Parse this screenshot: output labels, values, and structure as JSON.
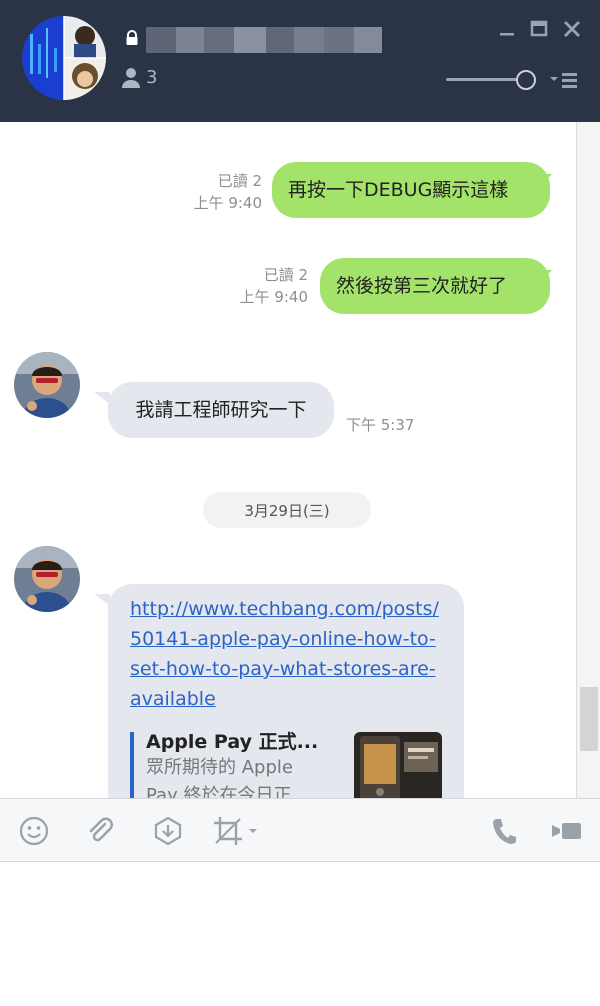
{
  "header": {
    "member_count": "3",
    "icons": [
      "lock-icon",
      "member-icon",
      "minimize-icon",
      "maximize-icon",
      "close-icon",
      "zoom-slider",
      "menu-icon"
    ]
  },
  "messages": [
    {
      "side": "out",
      "read": "已讀 2",
      "time": "上午 9:40",
      "text": "再按一下DEBUG顯示這樣"
    },
    {
      "side": "out",
      "read": "已讀 2",
      "time": "上午 9:40",
      "text": "然後按第三次就好了"
    },
    {
      "side": "in",
      "time": "下午 5:37",
      "text": "我請工程師研究一下"
    }
  ],
  "date_separator": "3月29日(三)",
  "link_message": {
    "url_lines": [
      "http://www.techbang.com/posts/",
      "50141-apple-pay-online-how-to-",
      "set-how-to-pay-what-stores-are-",
      "available"
    ],
    "preview_title": "Apple Pay 正式...",
    "preview_desc_1": "眾所期待的 Apple",
    "preview_desc_2": "Pay 終於在今日正"
  },
  "toolbar": {
    "icons": [
      "emoji-icon",
      "attach-icon",
      "download-icon",
      "screenshot-icon",
      "call-icon",
      "video-icon"
    ]
  },
  "colors": {
    "header_bg": "#2b3446",
    "outgoing_bubble": "#a4e36a",
    "incoming_bubble": "#e4e7ed",
    "link": "#2b64c8"
  }
}
